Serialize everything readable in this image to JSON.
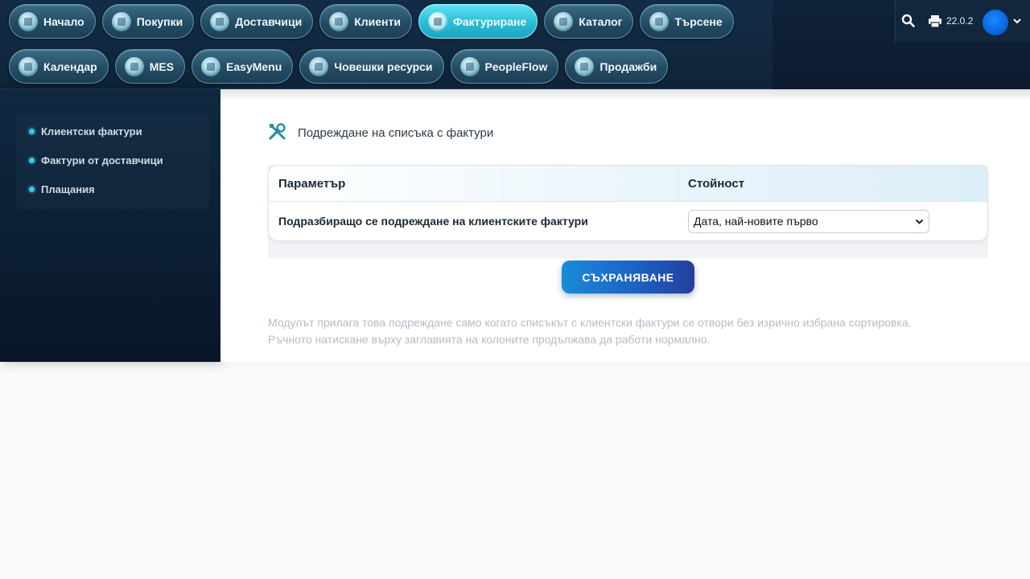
{
  "nav": {
    "row1": [
      {
        "label": "Начало",
        "icon": "dashboard-icon"
      },
      {
        "label": "Покупки",
        "icon": "cart-icon"
      },
      {
        "label": "Доставчици",
        "icon": "home-icon"
      },
      {
        "label": "Клиенти",
        "icon": "building-icon"
      },
      {
        "label": "Фактуриране",
        "icon": "invoice-icon",
        "active": true
      },
      {
        "label": "Каталог",
        "icon": "box-icon"
      },
      {
        "label": "Търсене",
        "icon": "home-search-icon"
      }
    ],
    "row2": [
      {
        "label": "Календар",
        "icon": "calendar-icon"
      },
      {
        "label": "MES",
        "icon": "factory-icon"
      },
      {
        "label": "EasyMenu",
        "icon": "menu-icon"
      },
      {
        "label": "Човешки ресурси",
        "icon": "people-icon"
      },
      {
        "label": "PeopleFlow",
        "icon": "flow-icon"
      },
      {
        "label": "Продажби",
        "icon": "sales-chart-icon"
      }
    ]
  },
  "toolbar": {
    "version": "22.0.2"
  },
  "sidebar": {
    "items": [
      {
        "label": "Клиентски фактури"
      },
      {
        "label": "Фактури от доставчици"
      },
      {
        "label": "Плащания"
      }
    ]
  },
  "main": {
    "title": "Подреждане на списъка с фактури",
    "table": {
      "col_param": "Параметър",
      "col_value": "Стойност",
      "row_label": "Подразбиращо се подреждане на клиентските фактури",
      "row_value": "Дата, най-новите първо"
    },
    "save_label": "СЪХРАНЯВАНЕ",
    "note_line1": "Модулът прилага това подреждане само когато списъкът с клиентски фактури се отвори без изрично избрана сортировка.",
    "note_line2": "Ръчното натискане върху заглавията на колоните продължава да работи нормално."
  },
  "colors": {
    "accent": "#29bdd6",
    "save_button": "#1d62c4",
    "nav_dark": "#132c45"
  }
}
